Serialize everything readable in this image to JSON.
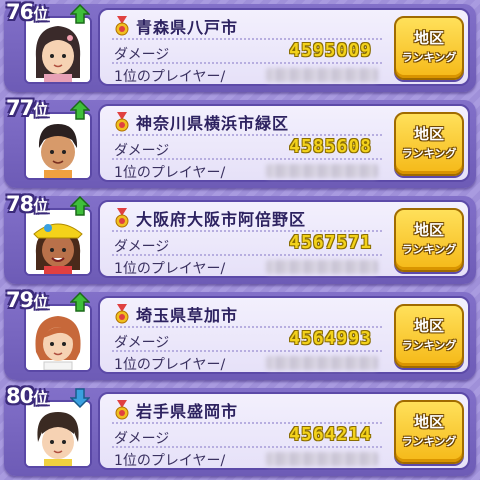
{
  "rows": [
    {
      "rank": "76",
      "rank_suffix": "位",
      "trend": "up",
      "arrow_icon": "green-up-arrow",
      "region": "青森県八戸市",
      "damage_label": "ダメージ",
      "damage": "4595009",
      "top_player_label": "1位のプレイヤー/",
      "button_line1": "地区",
      "button_line2": "ランキング"
    },
    {
      "rank": "77",
      "rank_suffix": "位",
      "trend": "up",
      "arrow_icon": "green-up-arrow",
      "region": "神奈川県横浜市緑区",
      "damage_label": "ダメージ",
      "damage": "4585608",
      "top_player_label": "1位のプレイヤー/",
      "button_line1": "地区",
      "button_line2": "ランキング"
    },
    {
      "rank": "78",
      "rank_suffix": "位",
      "trend": "up",
      "arrow_icon": "green-up-arrow",
      "region": "大阪府大阪市阿倍野区",
      "damage_label": "ダメージ",
      "damage": "4567571",
      "top_player_label": "1位のプレイヤー/",
      "button_line1": "地区",
      "button_line2": "ランキング"
    },
    {
      "rank": "79",
      "rank_suffix": "位",
      "trend": "up",
      "arrow_icon": "green-up-arrow",
      "region": "埼玉県草加市",
      "damage_label": "ダメージ",
      "damage": "4564993",
      "top_player_label": "1位のプレイヤー/",
      "button_line1": "地区",
      "button_line2": "ランキング"
    },
    {
      "rank": "80",
      "rank_suffix": "位",
      "trend": "down",
      "arrow_icon": "blue-down-arrow",
      "region": "岩手県盛岡市",
      "damage_label": "ダメージ",
      "damage": "4564214",
      "top_player_label": "1位のプレイヤー/",
      "button_line1": "地区",
      "button_line2": "ランキング"
    }
  ],
  "colors": {
    "background": "#a99be0",
    "row_frame": "#7563bf",
    "card": "#efebfb",
    "score_yellow": "#f3d21b",
    "button_gold": "#f7c52a",
    "up_arrow": "#3fbf3a",
    "down_arrow": "#3aa0e0"
  }
}
